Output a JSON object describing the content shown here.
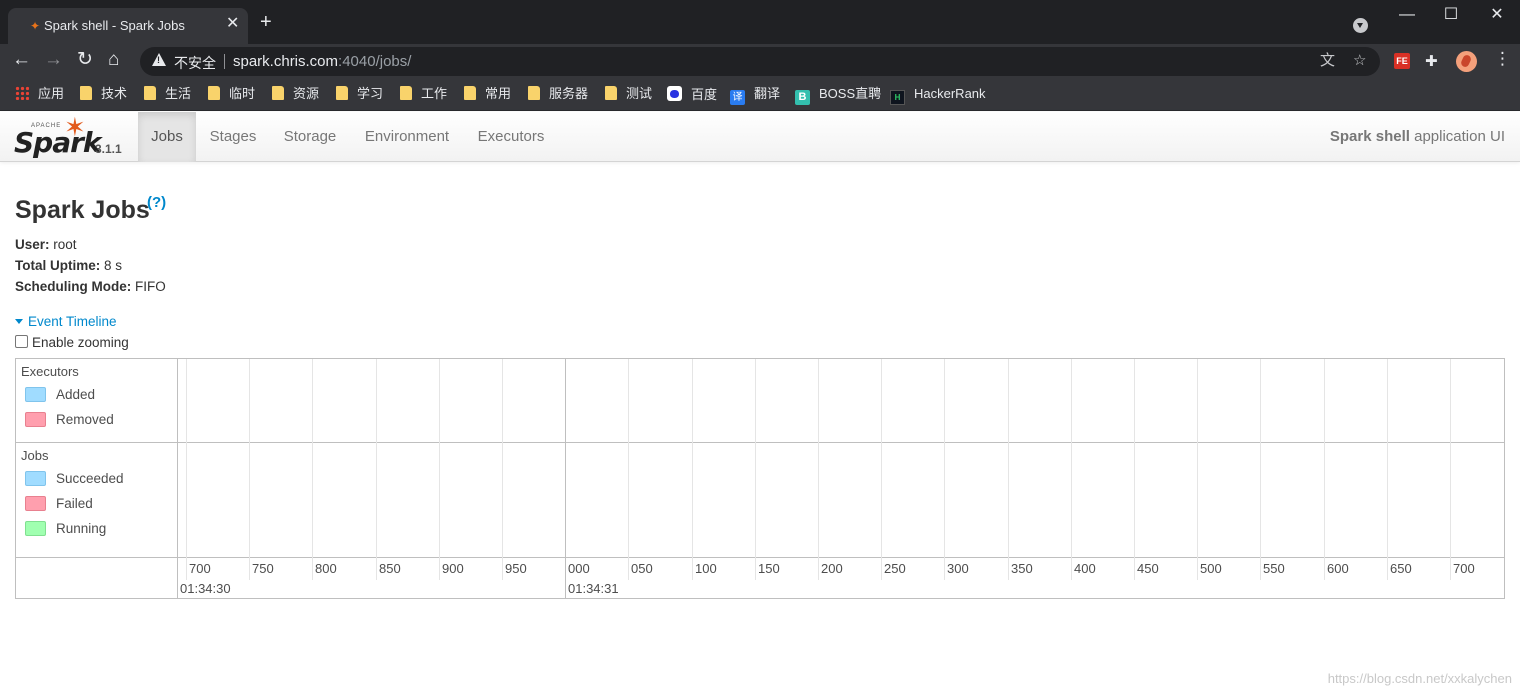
{
  "browser": {
    "tab_title": "Spark shell - Spark Jobs",
    "tab_close_glyph": "✕",
    "new_tab_glyph": "+",
    "window_controls": {
      "minimize": "—",
      "maximize": "☐",
      "close": "✕"
    },
    "not_secure_label": "不安全",
    "url_host": "spark.chris.com",
    "url_path": ":4040/jobs/",
    "icons": [
      "back-icon",
      "forward-icon",
      "reload-icon",
      "home-icon",
      "translate-icon",
      "star-icon",
      "extension-fe-icon",
      "puzzle-icon",
      "avatar",
      "kebab-menu-icon"
    ],
    "ext_fe_label": "FE"
  },
  "bookmarks": [
    {
      "label": "应用",
      "icon": "apps-grid-icon"
    },
    {
      "label": "技术",
      "icon": "folder-icon"
    },
    {
      "label": "生活",
      "icon": "folder-icon"
    },
    {
      "label": "临时",
      "icon": "folder-icon"
    },
    {
      "label": "资源",
      "icon": "folder-icon"
    },
    {
      "label": "学习",
      "icon": "folder-icon"
    },
    {
      "label": "工作",
      "icon": "folder-icon"
    },
    {
      "label": "常用",
      "icon": "folder-icon"
    },
    {
      "label": "服务器",
      "icon": "folder-icon"
    },
    {
      "label": "测试",
      "icon": "folder-icon"
    },
    {
      "label": "百度",
      "icon": "baidu-icon"
    },
    {
      "label": "翻译",
      "icon": "translate-site-icon",
      "glyph": "译"
    },
    {
      "label": "BOSS直聘",
      "icon": "boss-icon",
      "glyph": "B"
    },
    {
      "label": "HackerRank",
      "icon": "hackerrank-icon",
      "glyph": "H"
    }
  ],
  "spark": {
    "brand_apache": "APACHE",
    "brand_name": "Spark",
    "version": "3.1.1",
    "nav": [
      {
        "label": "Jobs",
        "active": true
      },
      {
        "label": "Stages"
      },
      {
        "label": "Storage"
      },
      {
        "label": "Environment"
      },
      {
        "label": "Executors"
      }
    ],
    "app_name": "Spark shell",
    "app_suffix": "application UI",
    "page_title": "Spark Jobs",
    "help": "(?)",
    "info": [
      {
        "label": "User:",
        "value": "root"
      },
      {
        "label": "Total Uptime:",
        "value": "8 s"
      },
      {
        "label": "Scheduling Mode:",
        "value": "FIFO"
      }
    ],
    "event_timeline": "Event Timeline",
    "enable_zooming": "Enable zooming",
    "timeline": {
      "executors_title": "Executors",
      "executor_legend": [
        {
          "label": "Added",
          "color": "#a0dcff"
        },
        {
          "label": "Removed",
          "color": "#ff9fae"
        }
      ],
      "jobs_title": "Jobs",
      "jobs_legend": [
        {
          "label": "Succeeded",
          "color": "#a0dcff"
        },
        {
          "label": "Failed",
          "color": "#ff9fae"
        },
        {
          "label": "Running",
          "color": "#a0ffb0"
        }
      ],
      "minor_ticks": [
        "700",
        "750",
        "800",
        "850",
        "900",
        "950",
        "000",
        "050",
        "100",
        "150",
        "200",
        "250",
        "300",
        "350",
        "400",
        "450",
        "500",
        "550",
        "600",
        "650",
        "700"
      ],
      "major_ticks": [
        {
          "label": "01:34:30",
          "index": 0
        },
        {
          "label": "01:34:31",
          "index": 6
        }
      ]
    }
  },
  "watermark": "https://blog.csdn.net/xxkalychen"
}
